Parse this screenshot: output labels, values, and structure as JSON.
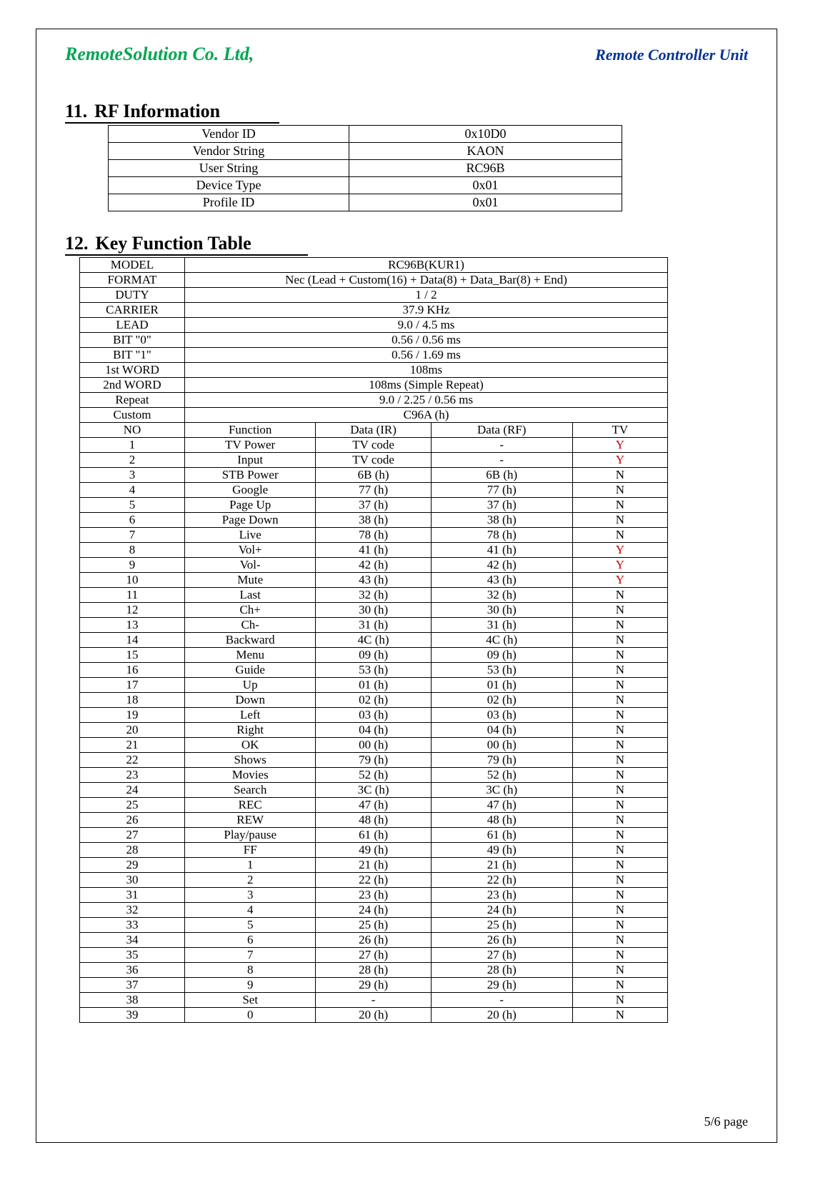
{
  "header": {
    "company": "RemoteSolution Co. Ltd,",
    "product": "Remote Controller Unit"
  },
  "sections": {
    "rf": {
      "number": "11.",
      "title": "RF Information"
    },
    "key": {
      "number": "12.",
      "title": "Key Function Table"
    }
  },
  "rf_table": [
    {
      "label": "Vendor ID",
      "value": "0x10D0"
    },
    {
      "label": "Vendor String",
      "value": "KAON"
    },
    {
      "label": "User String",
      "value": "RC96B"
    },
    {
      "label": "Device Type",
      "value": "0x01"
    },
    {
      "label": "Profile ID",
      "value": "0x01"
    }
  ],
  "key_table_header": [
    {
      "label": "MODEL",
      "value": "RC96B(KUR1)"
    },
    {
      "label": "FORMAT",
      "value": "Nec (Lead + Custom(16) + Data(8) + Data_Bar(8) + End)"
    },
    {
      "label": "DUTY",
      "value": "1 / 2"
    },
    {
      "label": "CARRIER",
      "value": "37.9 KHz"
    },
    {
      "label": "LEAD",
      "value": "9.0 / 4.5 ms"
    },
    {
      "label": "BIT \"0\"",
      "value": "0.56 / 0.56 ms"
    },
    {
      "label": "BIT \"1\"",
      "value": "0.56 / 1.69 ms"
    },
    {
      "label": "1st WORD",
      "value": "108ms"
    },
    {
      "label": "2nd WORD",
      "value": "108ms (Simple Repeat)"
    },
    {
      "label": "Repeat",
      "value": "9.0 / 2.25 / 0.56 ms"
    },
    {
      "label": "Custom",
      "value": "C96A (h)"
    }
  ],
  "key_table_columns": {
    "no": "NO",
    "fn": "Function",
    "ir": "Data (IR)",
    "rf": "Data (RF)",
    "tv": "TV"
  },
  "key_table_rows": [
    {
      "no": "1",
      "fn": "TV Power",
      "ir": "TV code",
      "rf": "-",
      "tv": "Y",
      "tv_highlight": true
    },
    {
      "no": "2",
      "fn": "Input",
      "ir": "TV code",
      "rf": "-",
      "tv": "Y",
      "tv_highlight": true
    },
    {
      "no": "3",
      "fn": "STB Power",
      "ir": "6B (h)",
      "rf": "6B (h)",
      "tv": "N"
    },
    {
      "no": "4",
      "fn": "Google",
      "ir": "77 (h)",
      "rf": "77 (h)",
      "tv": "N"
    },
    {
      "no": "5",
      "fn": "Page Up",
      "ir": "37 (h)",
      "rf": "37 (h)",
      "tv": "N"
    },
    {
      "no": "6",
      "fn": "Page Down",
      "ir": "38 (h)",
      "rf": "38 (h)",
      "tv": "N"
    },
    {
      "no": "7",
      "fn": "Live",
      "ir": "78 (h)",
      "rf": "78 (h)",
      "tv": "N"
    },
    {
      "no": "8",
      "fn": "Vol+",
      "ir": "41 (h)",
      "rf": "41 (h)",
      "tv": "Y",
      "tv_highlight": true
    },
    {
      "no": "9",
      "fn": "Vol-",
      "ir": "42 (h)",
      "rf": "42 (h)",
      "tv": "Y",
      "tv_highlight": true
    },
    {
      "no": "10",
      "fn": "Mute",
      "ir": "43 (h)",
      "rf": "43 (h)",
      "tv": "Y",
      "tv_highlight": true
    },
    {
      "no": "11",
      "fn": "Last",
      "ir": "32 (h)",
      "rf": "32 (h)",
      "tv": "N"
    },
    {
      "no": "12",
      "fn": "Ch+",
      "ir": "30 (h)",
      "rf": "30 (h)",
      "tv": "N"
    },
    {
      "no": "13",
      "fn": "Ch-",
      "ir": "31 (h)",
      "rf": "31 (h)",
      "tv": "N"
    },
    {
      "no": "14",
      "fn": "Backward",
      "ir": "4C (h)",
      "rf": "4C (h)",
      "tv": "N"
    },
    {
      "no": "15",
      "fn": "Menu",
      "ir": "09 (h)",
      "rf": "09 (h)",
      "tv": "N"
    },
    {
      "no": "16",
      "fn": "Guide",
      "ir": "53 (h)",
      "rf": "53 (h)",
      "tv": "N"
    },
    {
      "no": "17",
      "fn": "Up",
      "ir": "01 (h)",
      "rf": "01 (h)",
      "tv": "N"
    },
    {
      "no": "18",
      "fn": "Down",
      "ir": "02 (h)",
      "rf": "02 (h)",
      "tv": "N"
    },
    {
      "no": "19",
      "fn": "Left",
      "ir": "03 (h)",
      "rf": "03 (h)",
      "tv": "N"
    },
    {
      "no": "20",
      "fn": "Right",
      "ir": "04 (h)",
      "rf": "04 (h)",
      "tv": "N"
    },
    {
      "no": "21",
      "fn": "OK",
      "ir": "00 (h)",
      "rf": "00 (h)",
      "tv": "N"
    },
    {
      "no": "22",
      "fn": "Shows",
      "ir": "79 (h)",
      "rf": "79 (h)",
      "tv": "N"
    },
    {
      "no": "23",
      "fn": "Movies",
      "ir": "52 (h)",
      "rf": "52 (h)",
      "tv": "N"
    },
    {
      "no": "24",
      "fn": "Search",
      "ir": "3C (h)",
      "rf": "3C (h)",
      "tv": "N"
    },
    {
      "no": "25",
      "fn": "REC",
      "ir": "47 (h)",
      "rf": "47 (h)",
      "tv": "N"
    },
    {
      "no": "26",
      "fn": "REW",
      "ir": "48 (h)",
      "rf": "48 (h)",
      "tv": "N"
    },
    {
      "no": "27",
      "fn": "Play/pause",
      "ir": "61 (h)",
      "rf": "61 (h)",
      "tv": "N"
    },
    {
      "no": "28",
      "fn": "FF",
      "ir": "49 (h)",
      "rf": "49 (h)",
      "tv": "N"
    },
    {
      "no": "29",
      "fn": "1",
      "ir": "21 (h)",
      "rf": "21 (h)",
      "tv": "N"
    },
    {
      "no": "30",
      "fn": "2",
      "ir": "22 (h)",
      "rf": "22 (h)",
      "tv": "N"
    },
    {
      "no": "31",
      "fn": "3",
      "ir": "23 (h)",
      "rf": "23 (h)",
      "tv": "N"
    },
    {
      "no": "32",
      "fn": "4",
      "ir": "24 (h)",
      "rf": "24 (h)",
      "tv": "N"
    },
    {
      "no": "33",
      "fn": "5",
      "ir": "25 (h)",
      "rf": "25 (h)",
      "tv": "N"
    },
    {
      "no": "34",
      "fn": "6",
      "ir": "26 (h)",
      "rf": "26 (h)",
      "tv": "N"
    },
    {
      "no": "35",
      "fn": "7",
      "ir": "27 (h)",
      "rf": "27 (h)",
      "tv": "N"
    },
    {
      "no": "36",
      "fn": "8",
      "ir": "28 (h)",
      "rf": "28 (h)",
      "tv": "N"
    },
    {
      "no": "37",
      "fn": "9",
      "ir": "29 (h)",
      "rf": "29 (h)",
      "tv": "N"
    },
    {
      "no": "38",
      "fn": "Set",
      "ir": "-",
      "rf": "-",
      "tv": "N"
    },
    {
      "no": "39",
      "fn": "0",
      "ir": "20 (h)",
      "rf": "20 (h)",
      "tv": "N"
    }
  ],
  "footer": "5/6 page"
}
